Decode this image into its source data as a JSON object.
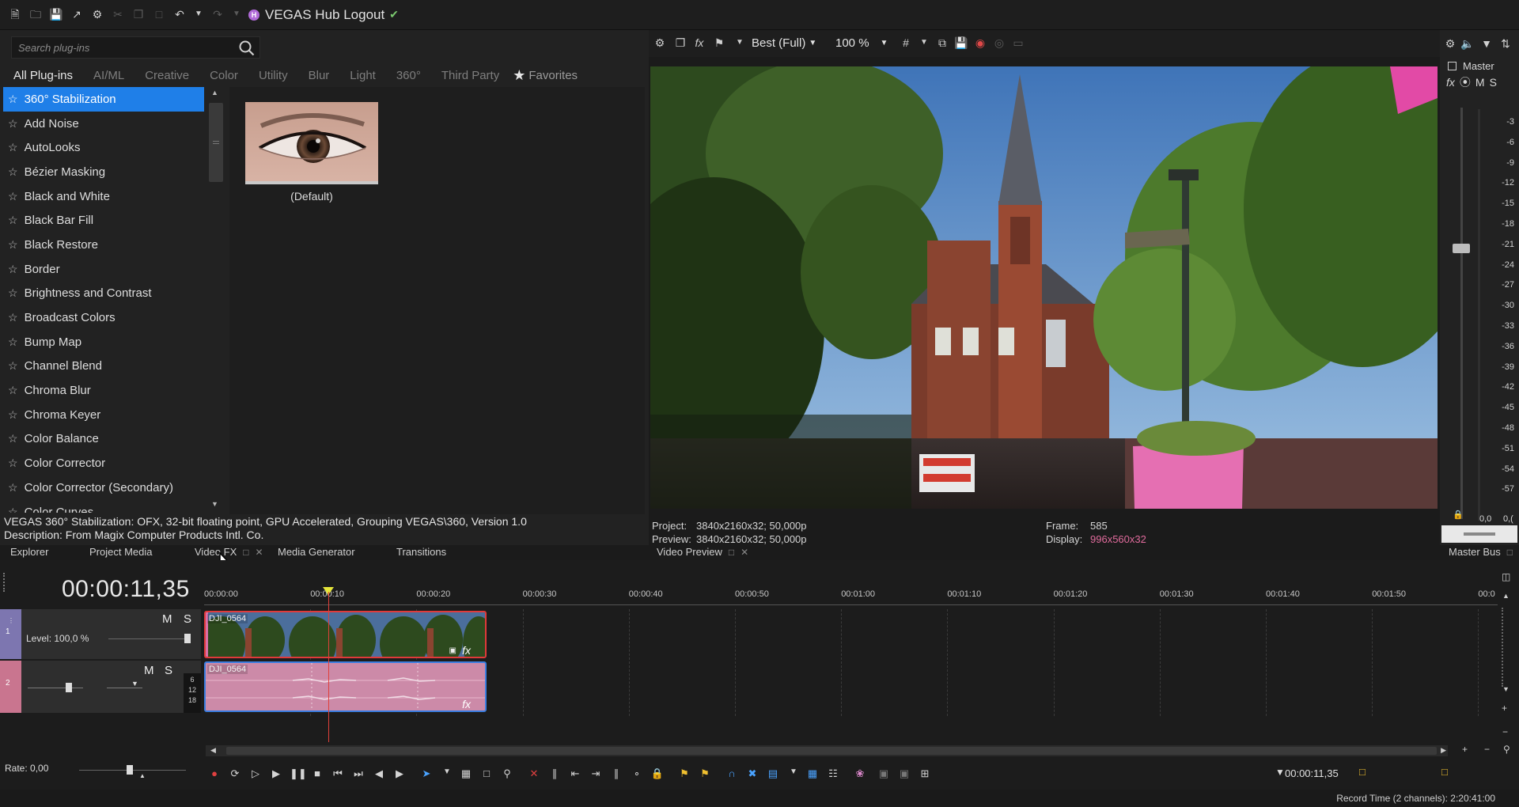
{
  "app": {
    "title": "VEGAS Hub Logout",
    "hub_badge": "H"
  },
  "plugins": {
    "search_placeholder": "Search plug-ins",
    "tabs": [
      "All Plug-ins",
      "AI/ML",
      "Creative",
      "Color",
      "Utility",
      "Blur",
      "Light",
      "360°",
      "Third Party"
    ],
    "favorites_label": "Favorites",
    "items": [
      "360° Stabilization",
      "Add Noise",
      "AutoLooks",
      "Bézier Masking",
      "Black and White",
      "Black Bar Fill",
      "Black Restore",
      "Border",
      "Brightness and Contrast",
      "Broadcast Colors",
      "Bump Map",
      "Channel Blend",
      "Chroma Blur",
      "Chroma Keyer",
      "Color Balance",
      "Color Corrector",
      "Color Corrector (Secondary)",
      "Color Curves"
    ],
    "selected_index": 0,
    "preset_label": "(Default)",
    "status_line1": "VEGAS 360° Stabilization: OFX, 32-bit floating point, GPU Accelerated, Grouping VEGAS\\360, Version 1.0",
    "status_line2": "Description: From Magix Computer Products Intl. Co."
  },
  "dock_tabs": {
    "explorer": "Explorer",
    "project_media": "Project Media",
    "video_fx": "Video FX",
    "media_generator": "Media Generator",
    "transitions": "Transitions",
    "video_preview": "Video Preview",
    "master_bus": "Master Bus"
  },
  "preview": {
    "quality": "Best (Full)",
    "zoom": "100 %",
    "project_label": "Project:",
    "project_value": "3840x2160x32; 50,000p",
    "preview_label": "Preview:",
    "preview_value": "3840x2160x32; 50,000p",
    "frame_label": "Frame:",
    "frame_value": "585",
    "display_label": "Display:",
    "display_value": "996x560x32"
  },
  "master": {
    "label": "Master",
    "m": "M",
    "s": "S",
    "meter_scale": [
      "-3",
      "-6",
      "-9",
      "-12",
      "-15",
      "-18",
      "-21",
      "-24",
      "-27",
      "-30",
      "-33",
      "-36",
      "-39",
      "-42",
      "-45",
      "-48",
      "-51",
      "-54",
      "-57"
    ],
    "readout_left": "0,0",
    "readout_right": "0,("
  },
  "timeline": {
    "time": "00:00:11,35",
    "ruler": [
      "00:00:00",
      "00:00:10",
      "00:00:20",
      "00:00:30",
      "00:00:40",
      "00:00:50",
      "00:01:00",
      "00:01:10",
      "00:01:20",
      "00:01:30",
      "00:01:40",
      "00:01:50",
      "00:0"
    ],
    "track1": {
      "number": "1",
      "level": "Level: 100,0 %",
      "m": "M",
      "s": "S"
    },
    "track2": {
      "number": "2",
      "m": "M",
      "s": "S",
      "db": [
        "6",
        "12",
        "18"
      ]
    },
    "video_clip_name": "DJI_0564",
    "audio_clip_name": "DJI_0564",
    "fx_label": "fx",
    "rate": "Rate: 0,00",
    "cursor_time": "00:00:11,35",
    "record_time": "Record Time (2 channels): 2:20:41:00"
  }
}
